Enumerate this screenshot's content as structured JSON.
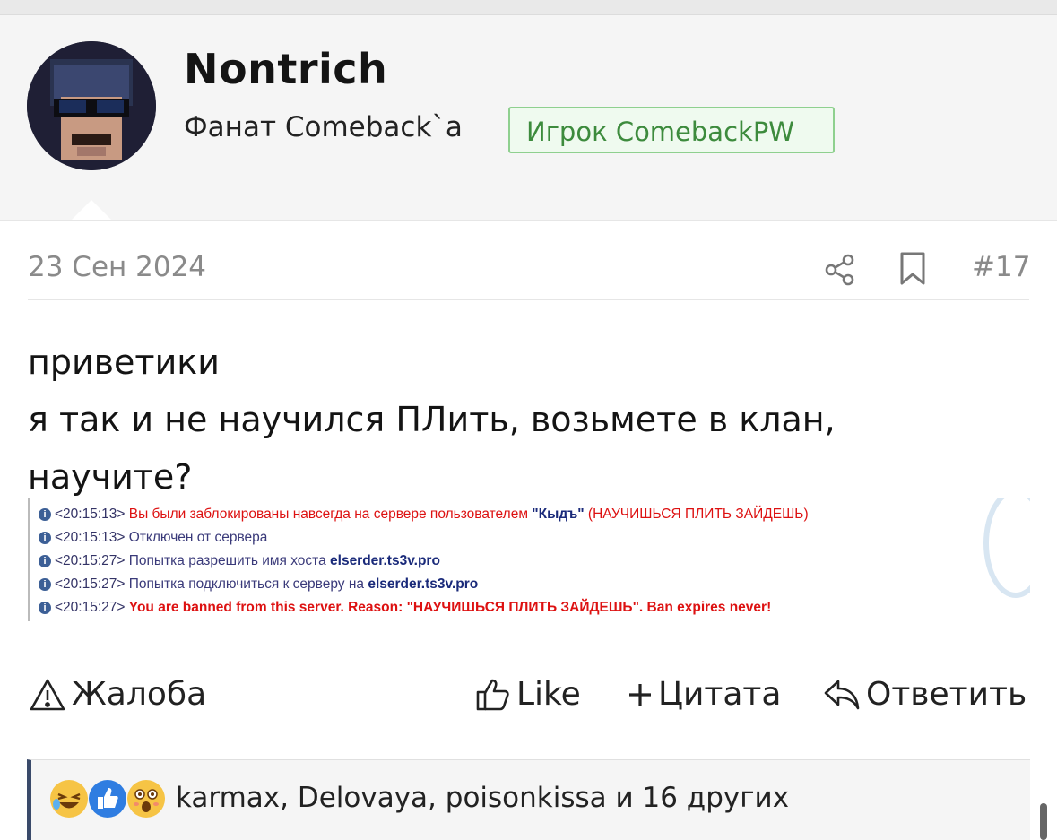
{
  "user": {
    "name": "Nontrich",
    "title": "Фанат Comeback`a",
    "badge": "Игрок ComebackPW"
  },
  "post": {
    "date": "23 Сен 2024",
    "number": "#17",
    "message_lines": [
      "приветики",
      "я так и не научился ПЛить, возьмете в клан,",
      "научите?"
    ]
  },
  "screenshot_log": [
    {
      "time": "<20:15:13>",
      "parts": [
        "Вы были заблокированы навсегда на сервере пользователем ",
        "\"Кыдъ\"",
        " (НАУЧИШЬСЯ ПЛИТЬ ЗАЙДЕШЬ)"
      ]
    },
    {
      "time": "<20:15:13>",
      "text": "Отключен от сервера"
    },
    {
      "time": "<20:15:27>",
      "parts": [
        "Попытка разрешить имя хоста ",
        "elserder.ts3v.pro"
      ]
    },
    {
      "time": "<20:15:27>",
      "parts": [
        "Попытка подключиться к серверу на ",
        "elserder.ts3v.pro"
      ]
    },
    {
      "time": "<20:15:27>",
      "text": "You are banned from this server. Reason: \"НАУЧИШЬСЯ ПЛИТЬ ЗАЙДЕШЬ\". Ban expires never!"
    }
  ],
  "actions": {
    "report": "Жалоба",
    "like": "Like",
    "quote": "Цитата",
    "reply": "Ответить"
  },
  "reactions": {
    "text": "karmax, Delovaya, poisonkissa и 16 других",
    "emojis": [
      "laughing-emoji",
      "like-emoji",
      "surprised-emoji"
    ]
  },
  "colors": {
    "badge_text": "#3d8b3d",
    "badge_border": "#8fd08f",
    "reaction_bar_accent": "#3a4a6a",
    "log_red": "#dd1111"
  }
}
